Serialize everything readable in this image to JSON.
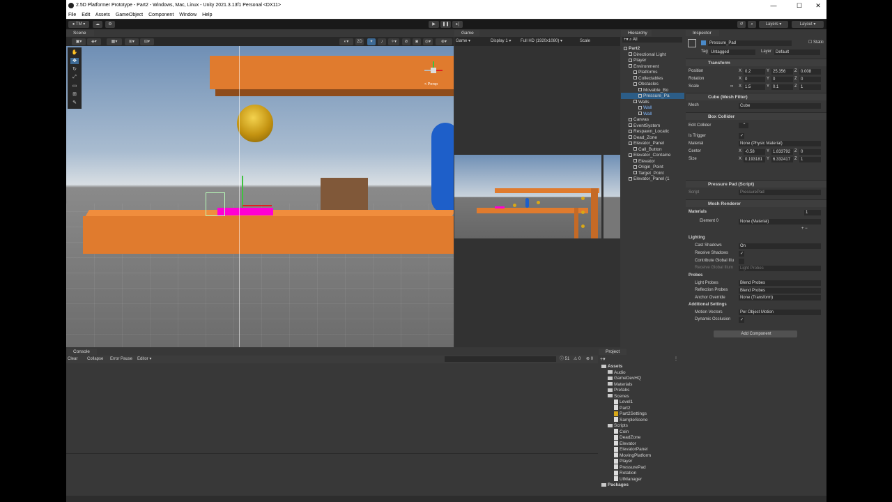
{
  "window": {
    "title": "2.5D Platformer Prototype - Part2 - Windows, Mac, Linux - Unity 2021.3.13f1 Personal <DX11>"
  },
  "menu": [
    "File",
    "Edit",
    "Assets",
    "GameObject",
    "Component",
    "Window",
    "Help"
  ],
  "toolbar": {
    "account": "TM",
    "layers": "Layers",
    "layout": "Layout"
  },
  "tabs": {
    "scene": "Scene",
    "game": "Game",
    "hierarchy": "Hierarchy",
    "inspector": "Inspector",
    "console": "Console",
    "project": "Project"
  },
  "scene": {
    "toggle2d": "2D",
    "persp": "< Persp"
  },
  "game": {
    "mode": "Game",
    "display": "Display 1",
    "resolution": "Full HD (1920x1080)",
    "scale": "Scale"
  },
  "hierarchy": {
    "search": "All",
    "items": [
      {
        "label": "Part2",
        "indent": 0,
        "kind": "scene"
      },
      {
        "label": "Directional Light",
        "indent": 1
      },
      {
        "label": "Player",
        "indent": 1
      },
      {
        "label": "Environment",
        "indent": 1
      },
      {
        "label": "Platforms",
        "indent": 2
      },
      {
        "label": "Collectables",
        "indent": 2
      },
      {
        "label": "Obstacles",
        "indent": 2
      },
      {
        "label": "Movable_Bo",
        "indent": 3
      },
      {
        "label": "Pressure_Pa",
        "indent": 3,
        "selected": true
      },
      {
        "label": "Walls",
        "indent": 2
      },
      {
        "label": "Wall",
        "indent": 3,
        "blue": true
      },
      {
        "label": "Wall",
        "indent": 3,
        "blue": true
      },
      {
        "label": "Canvas",
        "indent": 1
      },
      {
        "label": "EventSystem",
        "indent": 1
      },
      {
        "label": "Respawn_Locatic",
        "indent": 1
      },
      {
        "label": "Dead_Zone",
        "indent": 1
      },
      {
        "label": "Elevator_Panel",
        "indent": 1
      },
      {
        "label": "Call_Button",
        "indent": 2
      },
      {
        "label": "Elevator_Containe",
        "indent": 1
      },
      {
        "label": "Elevator",
        "indent": 2
      },
      {
        "label": "Origin_Point",
        "indent": 2
      },
      {
        "label": "Target_Point",
        "indent": 2
      },
      {
        "label": "Elevator_Panel (1",
        "indent": 1
      }
    ]
  },
  "inspector": {
    "name": "Pressure_Pad",
    "static": "Static",
    "tag_label": "Tag",
    "tag": "Untagged",
    "layer_label": "Layer",
    "layer": "Default",
    "transform": {
      "title": "Transform",
      "position_label": "Position",
      "rotation_label": "Rotation",
      "scale_label": "Scale",
      "position": {
        "x": "0.2",
        "y": "25.356",
        "z": "0.008"
      },
      "rotation": {
        "x": "0",
        "y": "0",
        "z": "0"
      },
      "scale": {
        "x": "1.5",
        "y": "0.1",
        "z": "1"
      }
    },
    "mesh_filter": {
      "title": "Cube (Mesh Filter)",
      "mesh_label": "Mesh",
      "mesh": "Cube"
    },
    "box_collider": {
      "title": "Box Collider",
      "edit": "Edit Collider",
      "trigger_label": "Is Trigger",
      "material_label": "Material",
      "material": "None (Physic Material)",
      "center_label": "Center",
      "size_label": "Size",
      "center": {
        "x": "-0.58",
        "y": "1.833792",
        "z": "0"
      },
      "size": {
        "x": "0.193181",
        "y": "6.332417",
        "z": "1"
      }
    },
    "script": {
      "title": "Pressure Pad (Script)",
      "label": "Script",
      "value": "PressurePad"
    },
    "mesh_renderer": {
      "title": "Mesh Renderer",
      "materials": "Materials",
      "materials_count": "1",
      "element0": "Element 0",
      "element0_value": "None (Material)",
      "lighting": "Lighting",
      "cast_shadows": "Cast Shadows",
      "cast_shadows_value": "On",
      "receive_shadows": "Receive Shadows",
      "contribute_gi": "Contribute Global Illu",
      "receive_gi": "Receive Global Illum",
      "receive_gi_value": "Light Probes",
      "probes": "Probes",
      "light_probes": "Light Probes",
      "light_probes_value": "Blend Probes",
      "reflection_probes": "Reflection Probes",
      "reflection_probes_value": "Blend Probes",
      "anchor_override": "Anchor Override",
      "anchor_override_value": "None (Transform)",
      "additional": "Additional Settings",
      "motion_vectors": "Motion Vectors",
      "motion_vectors_value": "Per Object Motion",
      "dynamic_occlusion": "Dynamic Occlusion"
    },
    "add_component": "Add Component"
  },
  "console": {
    "clear": "Clear",
    "collapse": "Collapse",
    "error_pause": "Error Pause",
    "editor": "Editor",
    "count": "51",
    "warn": "0",
    "err": "0"
  },
  "project": {
    "items": [
      {
        "label": "Assets",
        "indent": 0,
        "type": "folder",
        "bold": true
      },
      {
        "label": "Audio",
        "indent": 1,
        "type": "folder"
      },
      {
        "label": "GameDevHQ",
        "indent": 1,
        "type": "folder"
      },
      {
        "label": "Materials",
        "indent": 1,
        "type": "folder"
      },
      {
        "label": "Prefabs",
        "indent": 1,
        "type": "folder"
      },
      {
        "label": "Scenes",
        "indent": 1,
        "type": "folder"
      },
      {
        "label": "Level1",
        "indent": 2,
        "type": "scene"
      },
      {
        "label": "Part2",
        "indent": 2,
        "type": "scene"
      },
      {
        "label": "Part2Settings",
        "indent": 2,
        "type": "settings"
      },
      {
        "label": "SampleScene",
        "indent": 2,
        "type": "scene"
      },
      {
        "label": "Scripts",
        "indent": 1,
        "type": "folder"
      },
      {
        "label": "Coin",
        "indent": 2,
        "type": "file"
      },
      {
        "label": "DeadZone",
        "indent": 2,
        "type": "file"
      },
      {
        "label": "Elevator",
        "indent": 2,
        "type": "file"
      },
      {
        "label": "ElevatorPanel",
        "indent": 2,
        "type": "file"
      },
      {
        "label": "MovingPlatform",
        "indent": 2,
        "type": "file"
      },
      {
        "label": "Player",
        "indent": 2,
        "type": "file"
      },
      {
        "label": "PressurePad",
        "indent": 2,
        "type": "file"
      },
      {
        "label": "Rotation",
        "indent": 2,
        "type": "file"
      },
      {
        "label": "UIManager",
        "indent": 2,
        "type": "file"
      },
      {
        "label": "Packages",
        "indent": 0,
        "type": "folder",
        "bold": true
      }
    ]
  },
  "colors": {
    "platform": "#e07b2e",
    "pressure_pad": "#ff00d4",
    "coin": "#d9a817",
    "player": "#1e5fc9",
    "selection": "#2c5d87"
  }
}
